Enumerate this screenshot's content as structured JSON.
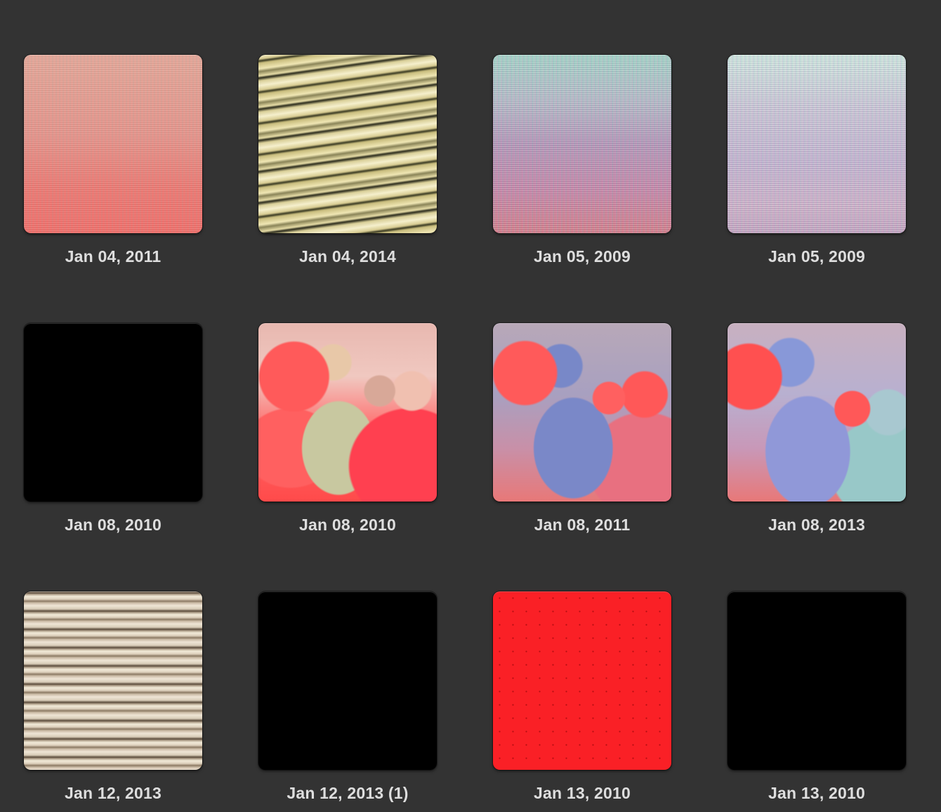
{
  "grid": {
    "items": [
      {
        "caption": "Jan 04, 2011"
      },
      {
        "caption": "Jan 04, 2014"
      },
      {
        "caption": "Jan 05, 2009"
      },
      {
        "caption": "Jan 05, 2009"
      },
      {
        "caption": "Jan 08, 2010"
      },
      {
        "caption": "Jan 08, 2010"
      },
      {
        "caption": "Jan 08, 2011"
      },
      {
        "caption": "Jan 08, 2013"
      },
      {
        "caption": "Jan 12, 2013"
      },
      {
        "caption": "Jan 12, 2013 (1)"
      },
      {
        "caption": "Jan 13, 2010"
      },
      {
        "caption": "Jan 13, 2010"
      }
    ]
  },
  "colors": {
    "background": "#333333",
    "caption_text": "#dedede"
  }
}
